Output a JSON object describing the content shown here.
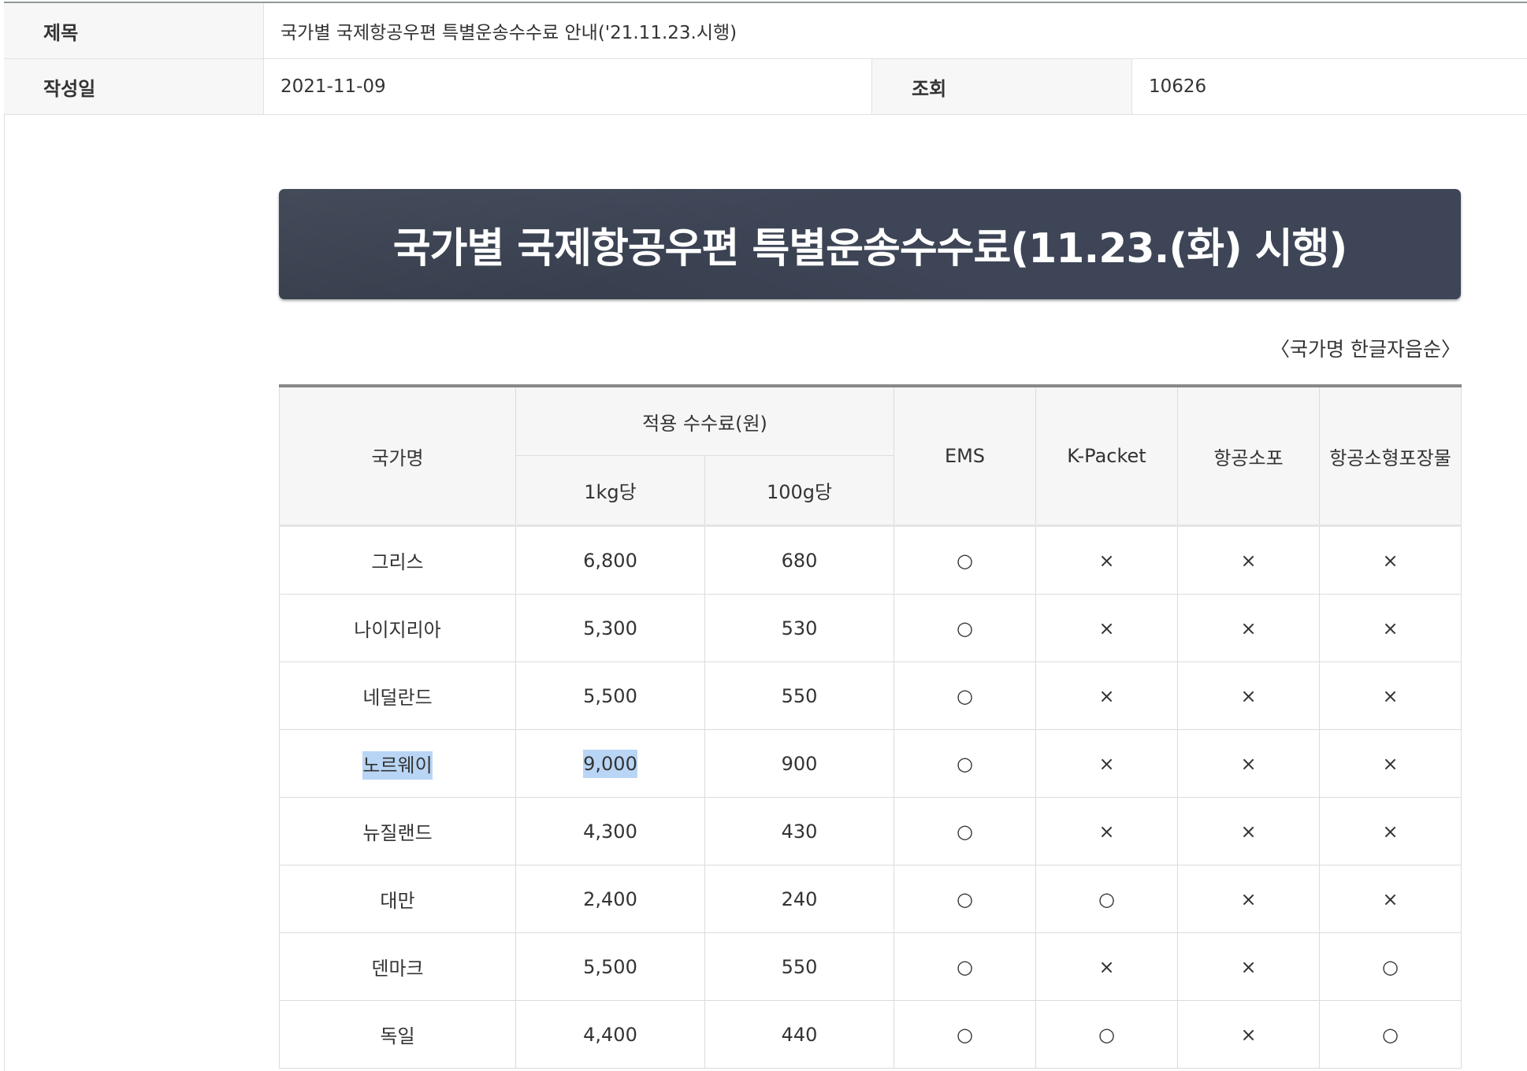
{
  "meta": {
    "title_label": "제목",
    "title_value": "국가별 국제항공우편 특별운송수수료 안내('21.11.23.시행)",
    "date_label": "작성일",
    "date_value": "2021-11-09",
    "views_label": "조회",
    "views_value": "10626"
  },
  "banner": {
    "title": "국가별 국제항공우편 특별운송수수료(11.23.(화) 시행)"
  },
  "note": "〈국가명 한글자음순〉",
  "table": {
    "headers": {
      "country": "국가명",
      "fee_group": "적용 수수료(원)",
      "per_kg": "1kg당",
      "per_100g": "100g당",
      "ems": "EMS",
      "kpacket": "K-Packet",
      "air_parcel": "항공소포",
      "air_small_packet": "항공소형포장물"
    },
    "rows": [
      {
        "country": "그리스",
        "per_kg": "6,800",
        "per_100g": "680",
        "ems": "○",
        "kpacket": "×",
        "air_parcel": "×",
        "air_small_packet": "×"
      },
      {
        "country": "나이지리아",
        "per_kg": "5,300",
        "per_100g": "530",
        "ems": "○",
        "kpacket": "×",
        "air_parcel": "×",
        "air_small_packet": "×"
      },
      {
        "country": "네덜란드",
        "per_kg": "5,500",
        "per_100g": "550",
        "ems": "○",
        "kpacket": "×",
        "air_parcel": "×",
        "air_small_packet": "×"
      },
      {
        "country": "노르웨이",
        "per_kg": "9,000",
        "per_100g": "900",
        "ems": "○",
        "kpacket": "×",
        "air_parcel": "×",
        "air_small_packet": "×"
      },
      {
        "country": "뉴질랜드",
        "per_kg": "4,300",
        "per_100g": "430",
        "ems": "○",
        "kpacket": "×",
        "air_parcel": "×",
        "air_small_packet": "×"
      },
      {
        "country": "대만",
        "per_kg": "2,400",
        "per_100g": "240",
        "ems": "○",
        "kpacket": "○",
        "air_parcel": "×",
        "air_small_packet": "×"
      },
      {
        "country": "덴마크",
        "per_kg": "5,500",
        "per_100g": "550",
        "ems": "○",
        "kpacket": "×",
        "air_parcel": "×",
        "air_small_packet": "○"
      },
      {
        "country": "독일",
        "per_kg": "4,400",
        "per_100g": "440",
        "ems": "○",
        "kpacket": "○",
        "air_parcel": "×",
        "air_small_packet": "○"
      }
    ],
    "selection_color": "#b9d5f5"
  }
}
